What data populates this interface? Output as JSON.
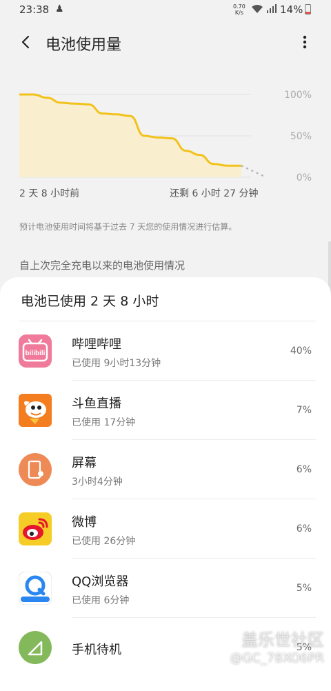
{
  "status_bar": {
    "time": "23:38",
    "speed": "0.70",
    "speed_unit": "K/s",
    "battery_pct": "14%"
  },
  "app_bar": {
    "title": "电池使用量",
    "back_icon": "back-arrow-icon",
    "more_icon": "more-vert-icon"
  },
  "chart": {
    "ticks": [
      "100%",
      "50%",
      "0%"
    ],
    "left_label": "2 天 8 小时前",
    "right_label": "还剩 6 小时 27 分钟"
  },
  "chart_data": {
    "type": "area",
    "ylim": [
      0,
      100
    ],
    "x_label_start": "2 天 8 小时前",
    "x_label_end": "还剩 6 小时 27 分钟",
    "series": [
      {
        "values": [
          100,
          100,
          96,
          90,
          89,
          88,
          77,
          76,
          74,
          50,
          48,
          47,
          32,
          27,
          16,
          14,
          14
        ]
      }
    ],
    "projection": {
      "values": [
        14,
        0
      ]
    },
    "colors": {
      "line": "#f2c21a",
      "fill": "#f9efcf",
      "projection": "#b8b8b8"
    }
  },
  "note": "预计电池使用时间将基于过去 7 天您的使用情况进行估算。",
  "section_title": "自上次完全充电以来的电池使用情况",
  "card": {
    "heading": "电池已使用 2 天 8 小时",
    "apps": [
      {
        "name": "哔哩哔哩",
        "sub": "已使用 9小时13分钟",
        "pct": "40%",
        "icon": "bilibili-icon"
      },
      {
        "name": "斗鱼直播",
        "sub": "已使用 17分钟",
        "pct": "7%",
        "icon": "douyu-icon"
      },
      {
        "name": "屏幕",
        "sub": "3小时4分钟",
        "pct": "6%",
        "icon": "screen-icon"
      },
      {
        "name": "微博",
        "sub": "已使用 26分钟",
        "pct": "6%",
        "icon": "weibo-icon"
      },
      {
        "name": "QQ浏览器",
        "sub": "已使用 6分钟",
        "pct": "5%",
        "icon": "qq-browser-icon"
      },
      {
        "name": "手机待机",
        "sub": "",
        "pct": "5%",
        "icon": "standby-icon"
      }
    ]
  },
  "watermark": {
    "line1": "盖乐世社区",
    "line2": "@GC_78XO6PR"
  }
}
